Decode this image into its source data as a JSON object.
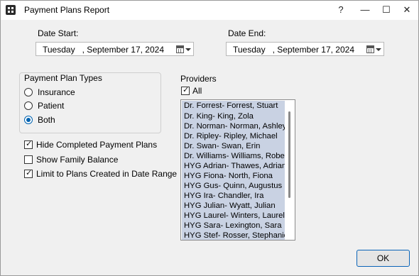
{
  "window": {
    "title": "Payment Plans Report",
    "help": "?",
    "minimize": "—",
    "maximize": "☐",
    "close": "✕"
  },
  "date_start": {
    "label": "Date Start:",
    "value": "Tuesday   , September 17, 2024"
  },
  "date_end": {
    "label": "Date End:",
    "value": "Tuesday   , September 17, 2024"
  },
  "plan_types": {
    "title": "Payment Plan Types",
    "options": [
      {
        "label": "Insurance",
        "selected": false
      },
      {
        "label": "Patient",
        "selected": false
      },
      {
        "label": "Both",
        "selected": true
      }
    ]
  },
  "options": [
    {
      "label": "Hide Completed Payment Plans",
      "checked": true
    },
    {
      "label": "Show Family Balance",
      "checked": false
    },
    {
      "label": "Limit to Plans Created in Date Range",
      "checked": true
    }
  ],
  "providers": {
    "label": "Providers",
    "all_label": "All",
    "all_checked": true,
    "items": [
      "Dr. Forrest- Forrest, Stuart",
      "Dr. King- King, Zola",
      "Dr. Norman- Norman, Ashley",
      "Dr. Ripley- Ripley, Michael",
      "Dr. Swan- Swan, Erin",
      "Dr. Williams- Williams, Robe",
      "HYG Adrian- Thawes, Adrian",
      "HYG Fiona- North, Fiona",
      "HYG Gus- Quinn, Augustus",
      "HYG Ira- Chandler, Ira",
      "HYG Julian- Wyatt, Julian",
      "HYG Laurel- Winters, Laurel",
      "HYG Sara- Lexington, Sara",
      "HYG Stef- Rosser, Stephanie"
    ]
  },
  "ok_label": "OK",
  "check_glyph": "✓"
}
